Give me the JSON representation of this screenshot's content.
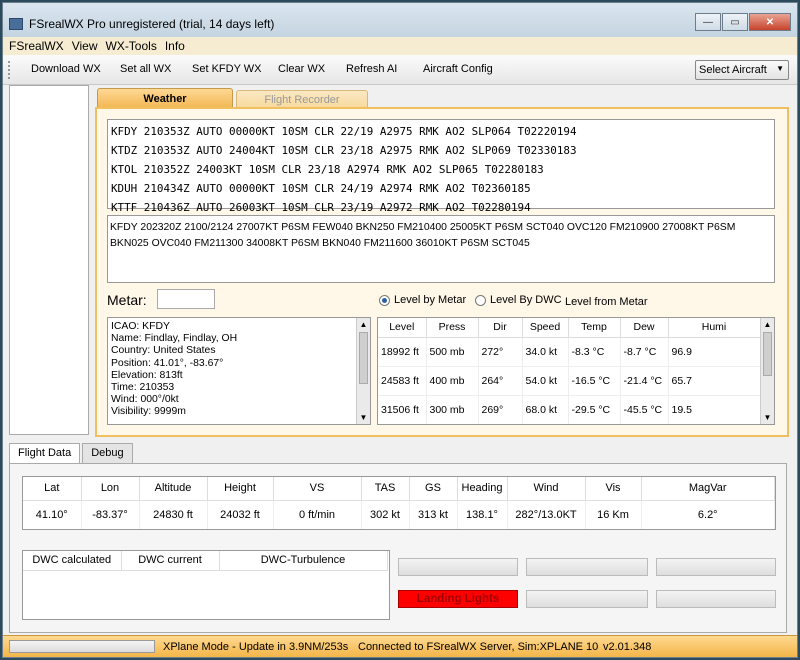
{
  "window": {
    "title": "FSrealWX Pro unregistered (trial, 14 days left)",
    "min_glyph": "—",
    "max_glyph": "▭",
    "close_glyph": "✕"
  },
  "menu": [
    "FSrealWX",
    "View",
    "WX-Tools",
    "Info"
  ],
  "toolbar": {
    "buttons": [
      "Download WX",
      "Set all WX",
      "Set KFDY WX",
      "Clear WX",
      "Refresh AI",
      "Aircraft Config"
    ],
    "select_aircraft": "Select Aircraft"
  },
  "tabs": {
    "weather": "Weather",
    "flight_recorder": "Flight Recorder"
  },
  "metars": [
    "KFDY 210353Z AUTO 00000KT 10SM CLR 22/19 A2975 RMK AO2 SLP064 T02220194",
    "KTDZ 210353Z AUTO 24004KT 10SM CLR 23/18 A2975 RMK AO2 SLP069 T02330183",
    "KTOL 210352Z 24003KT 10SM CLR 23/18 A2974 RMK AO2 SLP065 T02280183",
    "KDUH 210434Z AUTO 00000KT 10SM CLR 24/19 A2974 RMK AO2 T02360185",
    "KTTF 210436Z AUTO 26003KT 10SM CLR 23/19 A2972 RMK AO2 T02280194"
  ],
  "taf": "KFDY 202320Z 2100/2124 27007KT P6SM FEW040 BKN250   FM210400 25005KT P6SM SCT040 OVC120   FM210900 27008KT P6SM BKN025 OVC040   FM211300 34008KT P6SM BKN040   FM211600 36010KT P6SM SCT045",
  "metar_label": "Metar:",
  "metar_input": "",
  "radios": {
    "level_by_metar": "Level by Metar",
    "level_by_dwc": "Level By DWC",
    "level_from_metar": "Level from Metar"
  },
  "station_info": [
    "ICAO: KFDY",
    "Name: Findlay, Findlay, OH",
    "Country: United States",
    "Position: 41.01°, -83.67°",
    "Elevation: 813ft",
    "Time: 210353",
    "Wind: 000°/0kt",
    "Visibility: 9999m"
  ],
  "levels": {
    "headers": [
      "Level",
      "Press",
      "Dir",
      "Speed",
      "Temp",
      "Dew",
      "Humi"
    ],
    "rows": [
      [
        "18992 ft",
        "500 mb",
        "272°",
        "34.0 kt",
        "-8.3 °C",
        "-8.7 °C",
        "96.9"
      ],
      [
        "24583 ft",
        "400 mb",
        "264°",
        "54.0 kt",
        "-16.5 °C",
        "-21.4 °C",
        "65.7"
      ],
      [
        "31506 ft",
        "300 mb",
        "269°",
        "68.0 kt",
        "-29.5 °C",
        "-45.5 °C",
        "19.5"
      ]
    ]
  },
  "bottom_tabs": {
    "flight_data": "Flight Data",
    "debug": "Debug"
  },
  "flight_data": {
    "headers": [
      "Lat",
      "Lon",
      "Altitude",
      "Height",
      "VS",
      "TAS",
      "GS",
      "Heading",
      "Wind",
      "Vis",
      "MagVar"
    ],
    "values": [
      "41.10°",
      "-83.37°",
      "24830 ft",
      "24032 ft",
      "0 ft/min",
      "302 kt",
      "313 kt",
      "138.1°",
      "282°/13.0KT",
      "16 Km",
      "6.2°"
    ]
  },
  "dwc": {
    "headers": [
      "DWC calculated",
      "DWC current",
      "DWC-Turbulence"
    ]
  },
  "landing_lights": "Landing Lights",
  "status": {
    "mode": "XPlane Mode - Update in 3.9NM/253s",
    "connection": "Connected to FSrealWX Server, Sim:XPLANE 10",
    "version": "v2.01.348"
  },
  "colors": {
    "accent_orange": "#f2b752",
    "landing_red": "#ff0000"
  }
}
